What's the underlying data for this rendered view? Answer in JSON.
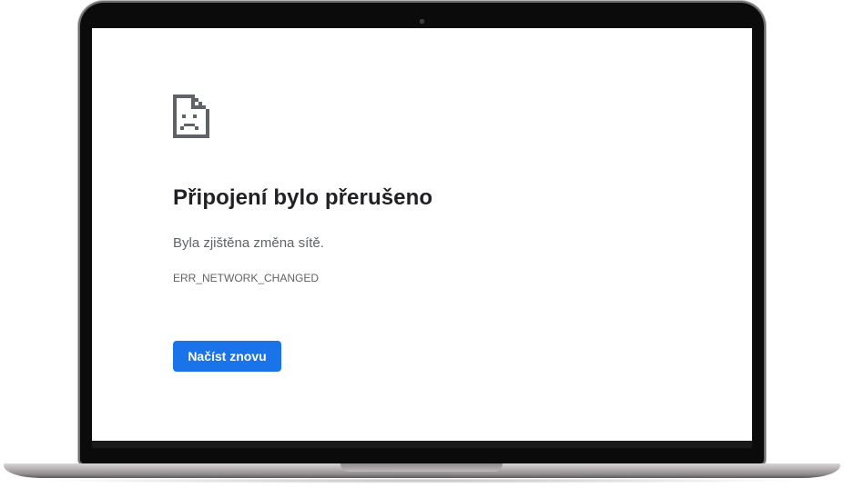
{
  "error_page": {
    "icon": "sad-document-icon",
    "headline": "Připojení bylo přerušeno",
    "subtext": "Byla zjištěna změna sítě.",
    "error_code": "ERR_NETWORK_CHANGED",
    "reload_button_label": "Načíst znovu"
  },
  "colors": {
    "headline": "#202124",
    "body_text": "#5f6368",
    "button_background": "#1a73e8",
    "button_text": "#ffffff",
    "icon": "#5f6368"
  }
}
